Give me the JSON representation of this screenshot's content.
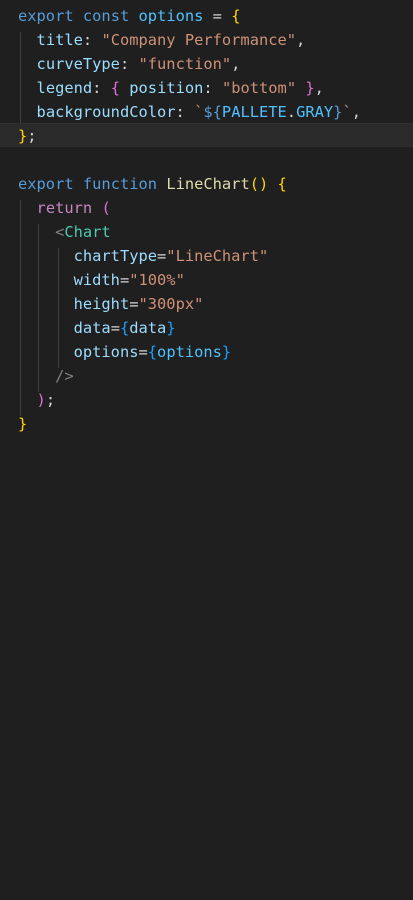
{
  "code": {
    "line1": {
      "export": "export",
      "const": "const",
      "name": "options",
      "eq": " = ",
      "open": "{"
    },
    "line2": {
      "key": "title",
      "colon": ": ",
      "value": "\"Company Performance\"",
      "comma": ","
    },
    "line3": {
      "key": "curveType",
      "colon": ": ",
      "value": "\"function\"",
      "comma": ","
    },
    "line4": {
      "key": "legend",
      "colon": ": ",
      "open": "{",
      "inner_key": "position",
      "inner_colon": ": ",
      "inner_value": "\"bottom\"",
      "close": "}",
      "comma": ","
    },
    "line5": {
      "key": "backgroundColor",
      "colon": ": ",
      "tick_open": "`",
      "interp_open": "${",
      "obj": "PALLETE",
      "dot": ".",
      "prop": "GRAY",
      "interp_close": "}",
      "tick_close": "`",
      "comma": ","
    },
    "line6": {
      "close": "}",
      "semi": ";"
    },
    "line8": {
      "export": "export",
      "function": "function",
      "name": "LineChart",
      "parens": "()",
      "open": "{"
    },
    "line9": {
      "return": "return",
      "open": "("
    },
    "line10": {
      "lt": "<",
      "component": "Chart"
    },
    "line11": {
      "attr": "chartType",
      "eq": "=",
      "value": "\"LineChart\""
    },
    "line12": {
      "attr": "width",
      "eq": "=",
      "value": "\"100%\""
    },
    "line13": {
      "attr": "height",
      "eq": "=",
      "value": "\"300px\""
    },
    "line14": {
      "attr": "data",
      "eq": "=",
      "open": "{",
      "value": "data",
      "close": "}"
    },
    "line15": {
      "attr": "options",
      "eq": "=",
      "open": "{",
      "value": "options",
      "close": "}"
    },
    "line16": {
      "selfclose": "/>"
    },
    "line17": {
      "close": ")",
      "semi": ";"
    },
    "line18": {
      "close": "}"
    }
  },
  "colors": {
    "background": "#1f1f1f",
    "keyword": "#569cd6",
    "control": "#c586c0",
    "variable": "#4fc1ff",
    "property": "#9cdcfe",
    "string": "#ce9178",
    "function": "#dcdcaa",
    "component": "#4ec9b0",
    "bracket_gold": "#ffd700",
    "bracket_orchid": "#da70d6",
    "bracket_blue": "#179fff"
  }
}
